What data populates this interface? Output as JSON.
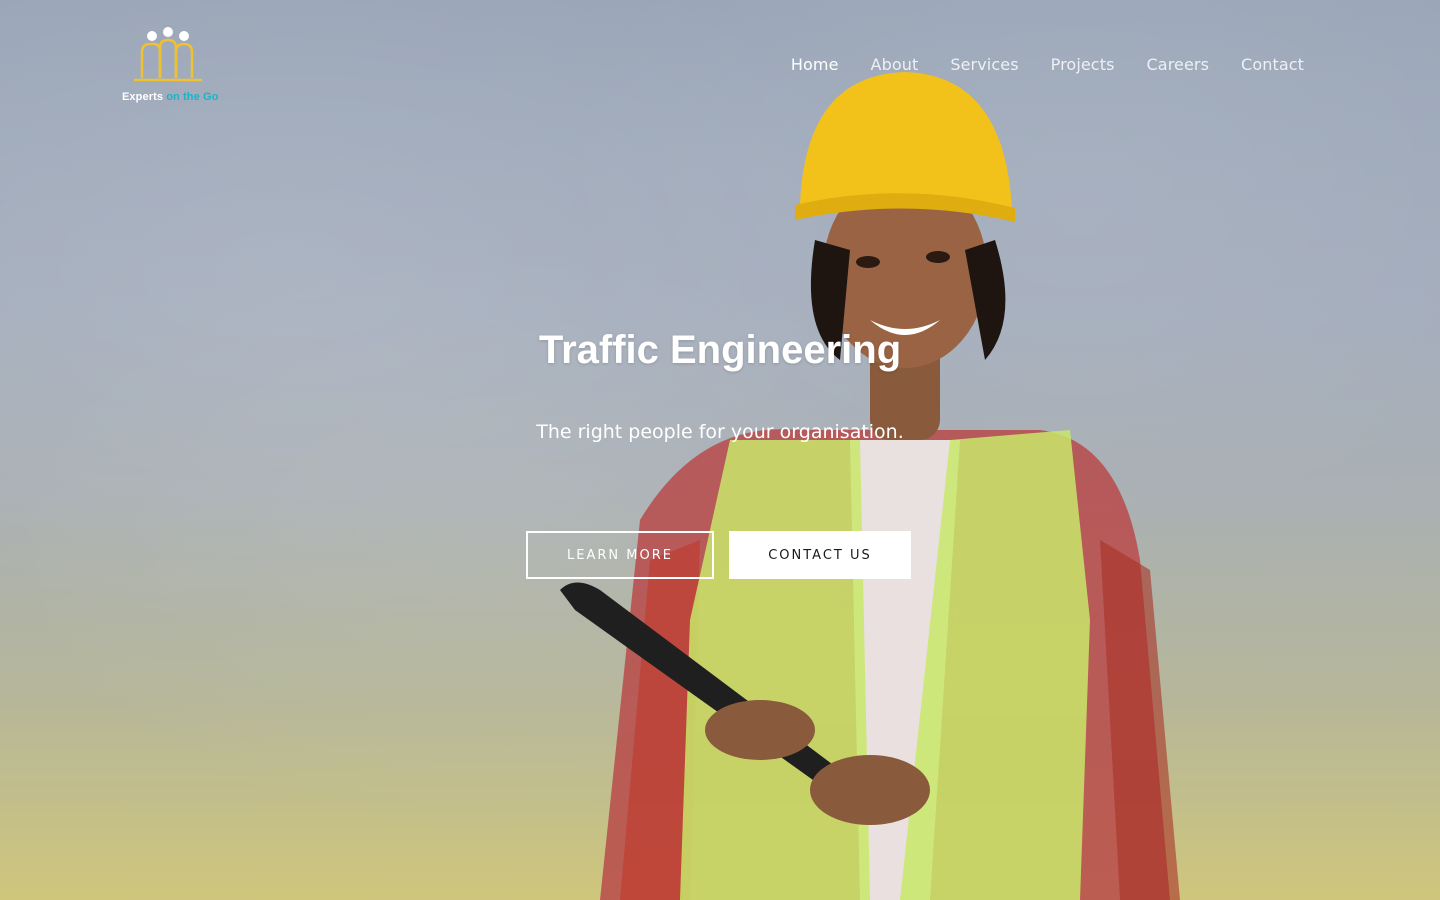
{
  "brand": {
    "logo_text_1": "Experts",
    "logo_text_2": "on the Go",
    "logo_icon": "people-bridge-logo-icon",
    "colors": {
      "logo_gold": "#f2c12e",
      "logo_teal": "#1fb2c4"
    }
  },
  "nav": {
    "items": [
      {
        "label": "Home",
        "active": true
      },
      {
        "label": "About"
      },
      {
        "label": "Services"
      },
      {
        "label": "Projects"
      },
      {
        "label": "Careers"
      },
      {
        "label": "Contact"
      }
    ]
  },
  "hero": {
    "title": "Traffic Engineering",
    "subtitle": "The right people for your organisation.",
    "primary_button": "LEARN MORE",
    "secondary_button": "CONTACT US"
  }
}
